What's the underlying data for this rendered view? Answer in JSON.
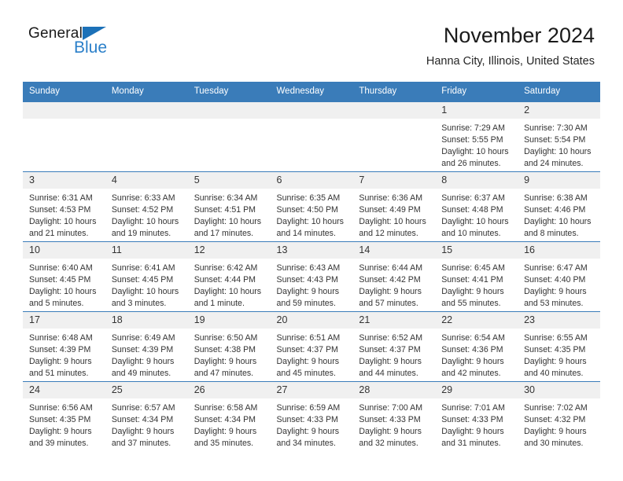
{
  "brand": {
    "name_dark": "General",
    "name_blue": "Blue",
    "accent_color": "#2a7fc9",
    "triangle_color": "#1c71b8"
  },
  "header": {
    "title": "November 2024",
    "subtitle": "Hanna City, Illinois, United States"
  },
  "calendar": {
    "header_bg": "#3a7cb9",
    "daynum_bg": "#f0f0f0",
    "weekday_headers": [
      "Sunday",
      "Monday",
      "Tuesday",
      "Wednesday",
      "Thursday",
      "Friday",
      "Saturday"
    ],
    "weeks": [
      [
        {
          "day": "",
          "sunrise": "",
          "sunset": "",
          "daylight_a": "",
          "daylight_b": ""
        },
        {
          "day": "",
          "sunrise": "",
          "sunset": "",
          "daylight_a": "",
          "daylight_b": ""
        },
        {
          "day": "",
          "sunrise": "",
          "sunset": "",
          "daylight_a": "",
          "daylight_b": ""
        },
        {
          "day": "",
          "sunrise": "",
          "sunset": "",
          "daylight_a": "",
          "daylight_b": ""
        },
        {
          "day": "",
          "sunrise": "",
          "sunset": "",
          "daylight_a": "",
          "daylight_b": ""
        },
        {
          "day": "1",
          "sunrise": "Sunrise: 7:29 AM",
          "sunset": "Sunset: 5:55 PM",
          "daylight_a": "Daylight: 10 hours",
          "daylight_b": "and 26 minutes."
        },
        {
          "day": "2",
          "sunrise": "Sunrise: 7:30 AM",
          "sunset": "Sunset: 5:54 PM",
          "daylight_a": "Daylight: 10 hours",
          "daylight_b": "and 24 minutes."
        }
      ],
      [
        {
          "day": "3",
          "sunrise": "Sunrise: 6:31 AM",
          "sunset": "Sunset: 4:53 PM",
          "daylight_a": "Daylight: 10 hours",
          "daylight_b": "and 21 minutes."
        },
        {
          "day": "4",
          "sunrise": "Sunrise: 6:33 AM",
          "sunset": "Sunset: 4:52 PM",
          "daylight_a": "Daylight: 10 hours",
          "daylight_b": "and 19 minutes."
        },
        {
          "day": "5",
          "sunrise": "Sunrise: 6:34 AM",
          "sunset": "Sunset: 4:51 PM",
          "daylight_a": "Daylight: 10 hours",
          "daylight_b": "and 17 minutes."
        },
        {
          "day": "6",
          "sunrise": "Sunrise: 6:35 AM",
          "sunset": "Sunset: 4:50 PM",
          "daylight_a": "Daylight: 10 hours",
          "daylight_b": "and 14 minutes."
        },
        {
          "day": "7",
          "sunrise": "Sunrise: 6:36 AM",
          "sunset": "Sunset: 4:49 PM",
          "daylight_a": "Daylight: 10 hours",
          "daylight_b": "and 12 minutes."
        },
        {
          "day": "8",
          "sunrise": "Sunrise: 6:37 AM",
          "sunset": "Sunset: 4:48 PM",
          "daylight_a": "Daylight: 10 hours",
          "daylight_b": "and 10 minutes."
        },
        {
          "day": "9",
          "sunrise": "Sunrise: 6:38 AM",
          "sunset": "Sunset: 4:46 PM",
          "daylight_a": "Daylight: 10 hours",
          "daylight_b": "and 8 minutes."
        }
      ],
      [
        {
          "day": "10",
          "sunrise": "Sunrise: 6:40 AM",
          "sunset": "Sunset: 4:45 PM",
          "daylight_a": "Daylight: 10 hours",
          "daylight_b": "and 5 minutes."
        },
        {
          "day": "11",
          "sunrise": "Sunrise: 6:41 AM",
          "sunset": "Sunset: 4:45 PM",
          "daylight_a": "Daylight: 10 hours",
          "daylight_b": "and 3 minutes."
        },
        {
          "day": "12",
          "sunrise": "Sunrise: 6:42 AM",
          "sunset": "Sunset: 4:44 PM",
          "daylight_a": "Daylight: 10 hours",
          "daylight_b": "and 1 minute."
        },
        {
          "day": "13",
          "sunrise": "Sunrise: 6:43 AM",
          "sunset": "Sunset: 4:43 PM",
          "daylight_a": "Daylight: 9 hours",
          "daylight_b": "and 59 minutes."
        },
        {
          "day": "14",
          "sunrise": "Sunrise: 6:44 AM",
          "sunset": "Sunset: 4:42 PM",
          "daylight_a": "Daylight: 9 hours",
          "daylight_b": "and 57 minutes."
        },
        {
          "day": "15",
          "sunrise": "Sunrise: 6:45 AM",
          "sunset": "Sunset: 4:41 PM",
          "daylight_a": "Daylight: 9 hours",
          "daylight_b": "and 55 minutes."
        },
        {
          "day": "16",
          "sunrise": "Sunrise: 6:47 AM",
          "sunset": "Sunset: 4:40 PM",
          "daylight_a": "Daylight: 9 hours",
          "daylight_b": "and 53 minutes."
        }
      ],
      [
        {
          "day": "17",
          "sunrise": "Sunrise: 6:48 AM",
          "sunset": "Sunset: 4:39 PM",
          "daylight_a": "Daylight: 9 hours",
          "daylight_b": "and 51 minutes."
        },
        {
          "day": "18",
          "sunrise": "Sunrise: 6:49 AM",
          "sunset": "Sunset: 4:39 PM",
          "daylight_a": "Daylight: 9 hours",
          "daylight_b": "and 49 minutes."
        },
        {
          "day": "19",
          "sunrise": "Sunrise: 6:50 AM",
          "sunset": "Sunset: 4:38 PM",
          "daylight_a": "Daylight: 9 hours",
          "daylight_b": "and 47 minutes."
        },
        {
          "day": "20",
          "sunrise": "Sunrise: 6:51 AM",
          "sunset": "Sunset: 4:37 PM",
          "daylight_a": "Daylight: 9 hours",
          "daylight_b": "and 45 minutes."
        },
        {
          "day": "21",
          "sunrise": "Sunrise: 6:52 AM",
          "sunset": "Sunset: 4:37 PM",
          "daylight_a": "Daylight: 9 hours",
          "daylight_b": "and 44 minutes."
        },
        {
          "day": "22",
          "sunrise": "Sunrise: 6:54 AM",
          "sunset": "Sunset: 4:36 PM",
          "daylight_a": "Daylight: 9 hours",
          "daylight_b": "and 42 minutes."
        },
        {
          "day": "23",
          "sunrise": "Sunrise: 6:55 AM",
          "sunset": "Sunset: 4:35 PM",
          "daylight_a": "Daylight: 9 hours",
          "daylight_b": "and 40 minutes."
        }
      ],
      [
        {
          "day": "24",
          "sunrise": "Sunrise: 6:56 AM",
          "sunset": "Sunset: 4:35 PM",
          "daylight_a": "Daylight: 9 hours",
          "daylight_b": "and 39 minutes."
        },
        {
          "day": "25",
          "sunrise": "Sunrise: 6:57 AM",
          "sunset": "Sunset: 4:34 PM",
          "daylight_a": "Daylight: 9 hours",
          "daylight_b": "and 37 minutes."
        },
        {
          "day": "26",
          "sunrise": "Sunrise: 6:58 AM",
          "sunset": "Sunset: 4:34 PM",
          "daylight_a": "Daylight: 9 hours",
          "daylight_b": "and 35 minutes."
        },
        {
          "day": "27",
          "sunrise": "Sunrise: 6:59 AM",
          "sunset": "Sunset: 4:33 PM",
          "daylight_a": "Daylight: 9 hours",
          "daylight_b": "and 34 minutes."
        },
        {
          "day": "28",
          "sunrise": "Sunrise: 7:00 AM",
          "sunset": "Sunset: 4:33 PM",
          "daylight_a": "Daylight: 9 hours",
          "daylight_b": "and 32 minutes."
        },
        {
          "day": "29",
          "sunrise": "Sunrise: 7:01 AM",
          "sunset": "Sunset: 4:33 PM",
          "daylight_a": "Daylight: 9 hours",
          "daylight_b": "and 31 minutes."
        },
        {
          "day": "30",
          "sunrise": "Sunrise: 7:02 AM",
          "sunset": "Sunset: 4:32 PM",
          "daylight_a": "Daylight: 9 hours",
          "daylight_b": "and 30 minutes."
        }
      ]
    ]
  }
}
